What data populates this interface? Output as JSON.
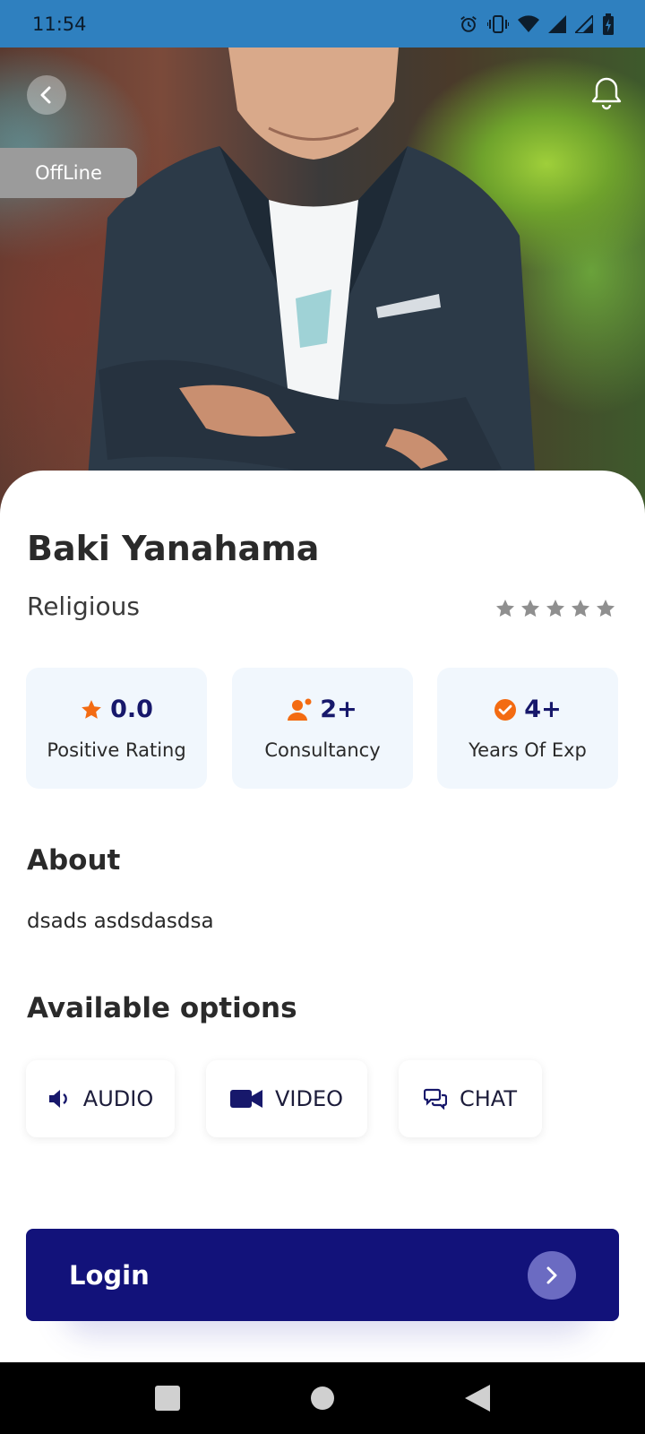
{
  "status_bar": {
    "time": "11:54",
    "icons": [
      "alarm-icon",
      "vibrate-icon",
      "wifi-icon",
      "signal-icon",
      "signal-icon",
      "battery-icon"
    ]
  },
  "header": {
    "back_icon": "chevron-left-icon",
    "bell_icon": "bell-icon",
    "status_badge": "OffLine"
  },
  "profile": {
    "name": "Baki Yanahama",
    "category": "Religious",
    "stars_filled": 0,
    "stars_total": 5
  },
  "stats": [
    {
      "icon": "star-icon",
      "value": "0.0",
      "label": "Positive Rating"
    },
    {
      "icon": "users-icon",
      "value": "2+",
      "label": "Consultancy"
    },
    {
      "icon": "check-circle-icon",
      "value": "4+",
      "label": "Years Of Exp"
    }
  ],
  "about": {
    "title": "About",
    "text": "dsads asdsdasdsa"
  },
  "options": {
    "title": "Available options",
    "items": [
      {
        "icon": "speaker-icon",
        "label": "AUDIO"
      },
      {
        "icon": "video-camera-icon",
        "label": "VIDEO"
      },
      {
        "icon": "chat-icon",
        "label": "CHAT"
      }
    ]
  },
  "login": {
    "label": "Login",
    "icon": "chevron-right-icon"
  },
  "colors": {
    "primary": "#12127a",
    "accent": "#f36b12",
    "status_bar": "#2f80bf",
    "card_bg": "#f1f7fd"
  }
}
